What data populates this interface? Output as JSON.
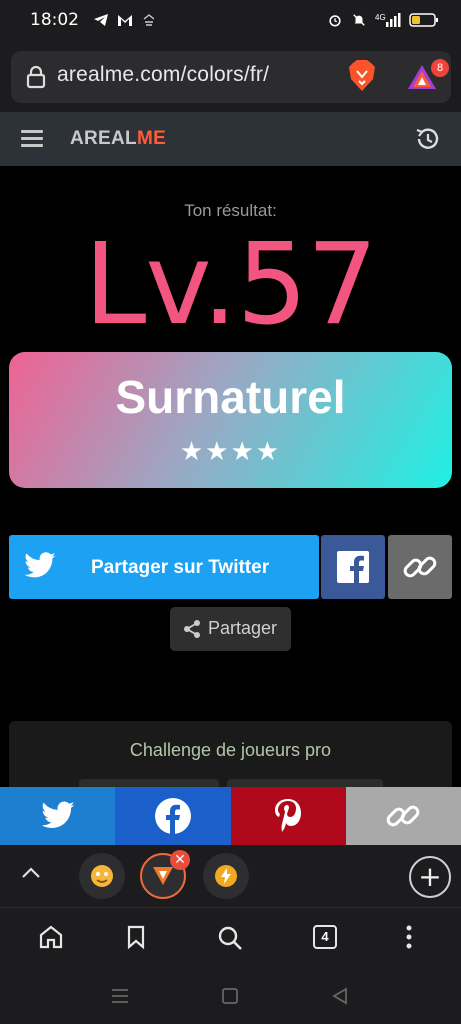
{
  "status_bar": {
    "time": "18:02",
    "battery_level": 0.3,
    "icons": [
      "telegram-icon",
      "gmail-icon",
      "download-icon",
      "alarm-icon",
      "mute-icon",
      "signal-4g-icon",
      "battery-icon"
    ]
  },
  "browser": {
    "url": "arealme.com/colors/fr/",
    "rewards_badge": "8",
    "tab_count": "4"
  },
  "site": {
    "logo_part1": "AREAL",
    "logo_part2": "ME"
  },
  "result": {
    "label": "Ton résultat:",
    "level": "Lv.57",
    "rank": "Surnaturel",
    "stars": "★★★★",
    "star_count": 4
  },
  "share": {
    "twitter_label": "Partager sur Twitter",
    "share_label": "Partager"
  },
  "challenge": {
    "title": "Challenge de joueurs pro"
  },
  "colors": {
    "level": "#f2557f",
    "twitter": "#1da1f2",
    "facebook": "#3b5998",
    "pinterest": "#b0091c",
    "logo_accent": "#ff5c3a"
  }
}
